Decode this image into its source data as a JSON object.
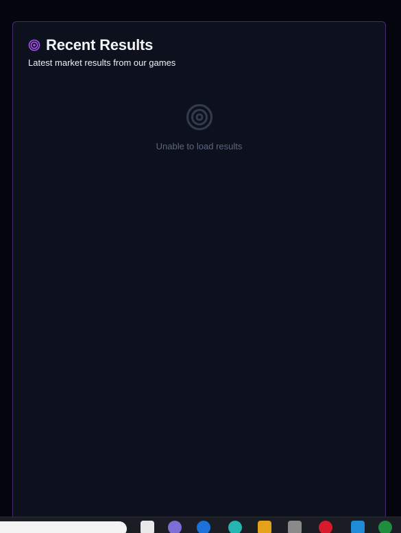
{
  "card": {
    "title": "Recent Results",
    "subtitle": "Latest market results from our games",
    "empty_message": "Unable to load results"
  },
  "icons": {
    "title_icon": "target-icon",
    "empty_icon": "target-icon"
  },
  "colors": {
    "accent": "#a855f7",
    "card_border": "#4b2a73",
    "card_bg": "#0c111d",
    "page_bg": "#04050d",
    "muted_text": "#5c677f",
    "empty_icon": "#323b4c"
  },
  "taskbar": {
    "apps": [
      {
        "name": "file-icon",
        "color": "#e8e8e8"
      },
      {
        "name": "copilot-icon",
        "color": "#7b6fd6"
      },
      {
        "name": "edge-icon",
        "color": "#1a73d9"
      },
      {
        "name": "chat-icon",
        "color": "#23b6b0"
      },
      {
        "name": "folder-icon",
        "color": "#e3a21a"
      },
      {
        "name": "app-icon",
        "color": "#8a8a8a"
      },
      {
        "name": "opera-icon",
        "color": "#d81b2c"
      },
      {
        "name": "vscode-icon",
        "color": "#1f8ad6"
      },
      {
        "name": "chrome-icon",
        "color": "#1e8e3e"
      }
    ]
  }
}
